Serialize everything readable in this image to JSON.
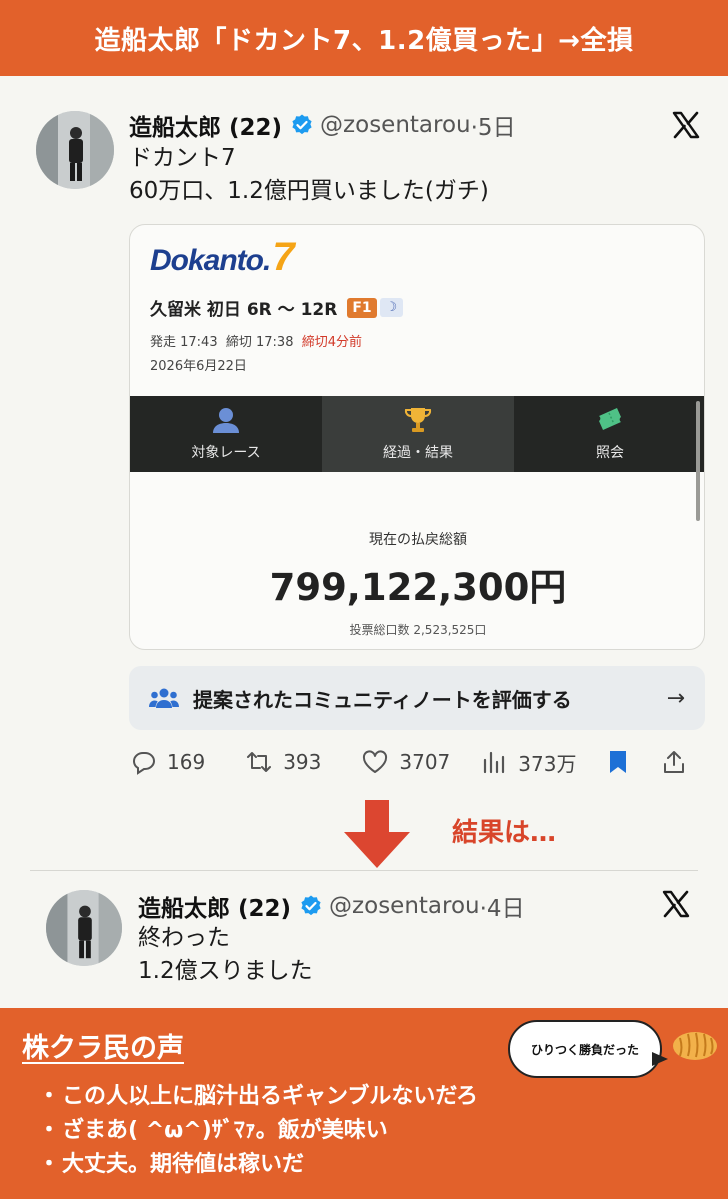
{
  "banner": {
    "title": "造船太郎「ドカント7、1.2億買った」→全損"
  },
  "tweet1": {
    "name": "造船太郎 (22)",
    "handle": "@zosentarou",
    "time": "·5日",
    "line1": "ドカント7",
    "line2": "60万口、1.2億円買いました(ガチ)"
  },
  "card": {
    "logo_text": "Dokanto.",
    "logo_num": "7",
    "race": "久留米 初日 6R 〜 12R",
    "badge_f1": "F1",
    "badge_moon": "☽",
    "times_start": "発走 17:43",
    "times_close": "締切 17:38",
    "times_remaining": "締切4分前",
    "date": "2026年6月22日",
    "tabs": [
      {
        "label": "対象レース",
        "icon": "person-icon"
      },
      {
        "label": "経過・結果",
        "icon": "trophy-icon"
      },
      {
        "label": "照会",
        "icon": "ticket-icon"
      }
    ],
    "payout_label": "現在の払戻総額",
    "payout_amount": "799,122,300円",
    "votes": "投票総口数 2,523,525口"
  },
  "community": {
    "label": "提案されたコミュニティノートを評価する",
    "arrow": "→"
  },
  "actions": {
    "replies": "169",
    "retweets": "393",
    "likes": "3707",
    "views": "373万"
  },
  "result_label": "結果は…",
  "tweet2": {
    "name": "造船太郎 (22)",
    "handle": "@zosentarou",
    "time": "·4日",
    "line1": "終わった",
    "line2": "1.2億スりました"
  },
  "footer": {
    "title": "株クラ民の声",
    "bubble": "ひりつく勝負だった",
    "comments": [
      "この人以上に脳汁出るギャンブルないだろ",
      "ざまあ( ^ω^)ｻﾞﾏｧ。飯が美味い",
      "大丈夫。期待値は稼いだ"
    ]
  },
  "colors": {
    "accent": "#e2612b",
    "verified": "#1d9bf0",
    "result_red": "#d8452a",
    "arrow_red": "#dc4630"
  }
}
